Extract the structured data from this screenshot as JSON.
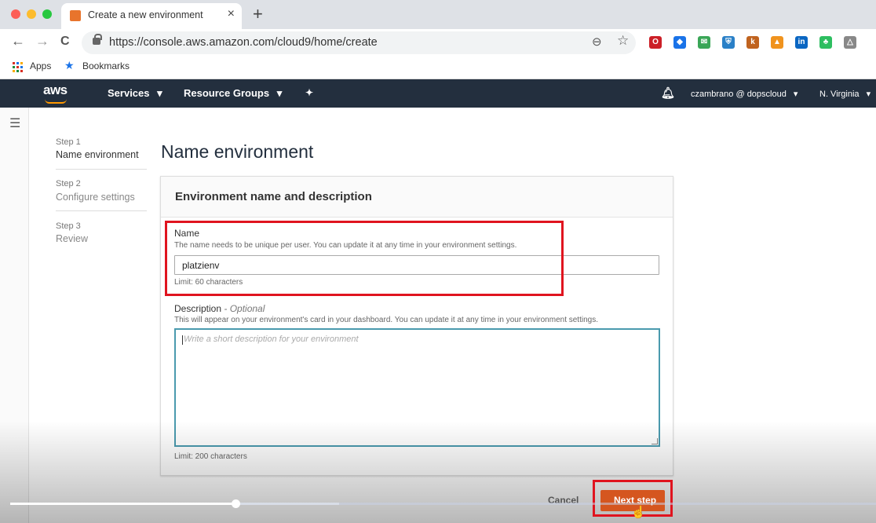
{
  "browser": {
    "tab_title": "Create a new environment",
    "tab_close": "×",
    "new_tab": "+",
    "url": "https://console.aws.amazon.com/cloud9/home/create",
    "bookmarks_apps": "Apps",
    "bookmarks_label": "Bookmarks",
    "nav_back": "←",
    "nav_forward": "→",
    "nav_reload": "C",
    "zoom_icon": "⊖",
    "star_icon": "☆",
    "extensions": [
      {
        "name": "opera-icon",
        "glyph": "O",
        "color": "#cc1f27"
      },
      {
        "name": "diamond-icon",
        "glyph": "◆",
        "color": "#1a73e8"
      },
      {
        "name": "mail-icon",
        "glyph": "✉",
        "color": "#3aa657"
      },
      {
        "name": "shield-icon",
        "glyph": "⛨",
        "color": "#2a80c7"
      },
      {
        "name": "k-icon",
        "glyph": "k",
        "color": "#c0631f"
      },
      {
        "name": "triangle-icon",
        "glyph": "▲",
        "color": "#f0931e"
      },
      {
        "name": "linkedin-icon",
        "glyph": "in",
        "color": "#0a66c2"
      },
      {
        "name": "evernote-icon",
        "glyph": "♣",
        "color": "#2dbe60"
      },
      {
        "name": "drive-icon",
        "glyph": "△",
        "color": "#888888"
      }
    ]
  },
  "aws_nav": {
    "logo": "aws",
    "services": "Services",
    "resource_groups": "Resource Groups",
    "user": "czambrano @ dopscloud",
    "region": "N. Virginia",
    "caret": "▾"
  },
  "steps": [
    {
      "number": "Step 1",
      "name": "Name environment",
      "active": true
    },
    {
      "number": "Step 2",
      "name": "Configure settings",
      "active": false
    },
    {
      "number": "Step 3",
      "name": "Review",
      "active": false
    }
  ],
  "page_title": "Name environment",
  "panel": {
    "title": "Environment name and description",
    "name_label": "Name",
    "name_help": "The name needs to be unique per user. You can update it at any time in your environment settings.",
    "name_value": "platzienv",
    "name_limit": "Limit: 60 characters",
    "desc_label": "Description",
    "desc_optional": " - Optional",
    "desc_help": "This will appear on your environment's card in your dashboard. You can update it at any time in your environment settings.",
    "desc_placeholder": "Write a short description for your environment",
    "desc_limit": "Limit: 200 characters"
  },
  "actions": {
    "cancel": "Cancel",
    "next": "Next step"
  },
  "video": {
    "progress": 0.26,
    "buffered": 0.38
  },
  "colors": {
    "aws_nav_bg": "#232f3e",
    "aws_orange": "#ff9900",
    "primary_button": "#d5561f",
    "highlight_box": "#e0141f",
    "focus_border": "#4a9aae"
  }
}
